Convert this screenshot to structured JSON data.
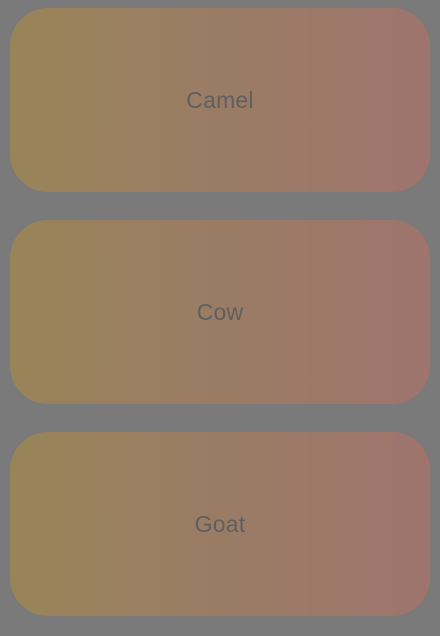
{
  "cards": [
    {
      "label": "Camel"
    },
    {
      "label": "Cow"
    },
    {
      "label": "Goat"
    }
  ],
  "colors": {
    "background": "#7a7a7a",
    "card_gradient_start": "#998458",
    "card_gradient_end": "#9f746d",
    "label_text": "#5f5f5f"
  }
}
